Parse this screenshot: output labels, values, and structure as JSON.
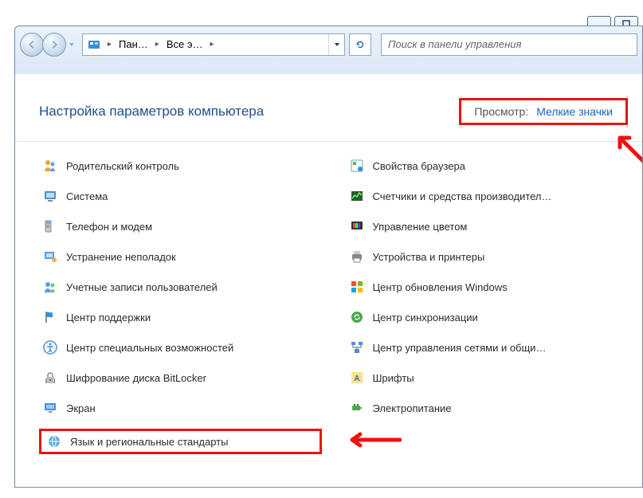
{
  "window": {
    "minimize": "Minimize",
    "maximize": "Maximize"
  },
  "breadcrumb": {
    "seg1": "Пан…",
    "seg2": "Все э…"
  },
  "search": {
    "placeholder": "Поиск в панели управления"
  },
  "page": {
    "title": "Настройка параметров компьютера",
    "view_label": "Просмотр:",
    "view_value": "Мелкие значки"
  },
  "items": {
    "left": [
      {
        "id": "parental",
        "label": "Родительский контроль"
      },
      {
        "id": "system",
        "label": "Система"
      },
      {
        "id": "phone",
        "label": "Телефон и модем"
      },
      {
        "id": "trouble",
        "label": "Устранение неполадок"
      },
      {
        "id": "users",
        "label": "Учетные записи пользователей"
      },
      {
        "id": "support",
        "label": "Центр поддержки"
      },
      {
        "id": "access",
        "label": "Центр специальных возможностей"
      },
      {
        "id": "bitlocker",
        "label": "Шифрование диска BitLocker"
      },
      {
        "id": "display",
        "label": "Экран"
      },
      {
        "id": "region",
        "label": "Язык и региональные стандарты"
      }
    ],
    "right": [
      {
        "id": "browser",
        "label": "Свойства браузера"
      },
      {
        "id": "perfcount",
        "label": "Счетчики и средства производител…"
      },
      {
        "id": "color",
        "label": "Управление цветом"
      },
      {
        "id": "printers",
        "label": "Устройства и принтеры"
      },
      {
        "id": "winupdate",
        "label": "Центр обновления Windows"
      },
      {
        "id": "sync",
        "label": "Центр синхронизации"
      },
      {
        "id": "network",
        "label": "Центр управления сетями и общи…"
      },
      {
        "id": "fonts",
        "label": "Шрифты"
      },
      {
        "id": "power",
        "label": "Электропитание"
      }
    ]
  }
}
